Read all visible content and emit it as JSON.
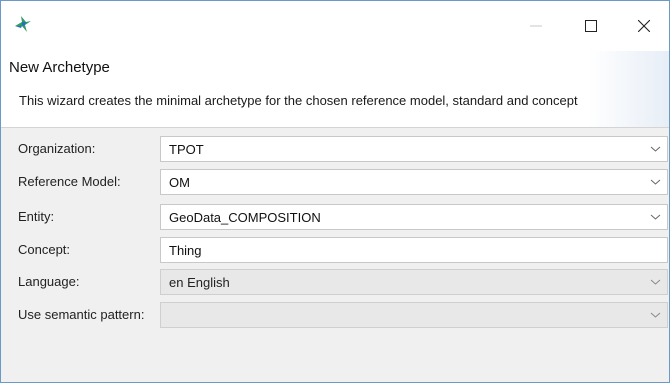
{
  "window": {
    "icon": "archetype-editor-icon",
    "controls": {
      "minimize": "minimize-icon",
      "maximize": "maximize-icon",
      "close": "close-icon"
    }
  },
  "wizard": {
    "title": "New Archetype",
    "description": "This wizard creates the minimal archetype for the chosen reference model, standard and concept"
  },
  "form": {
    "organization": {
      "label": "Organization:",
      "value": "TPOT"
    },
    "reference_model": {
      "label": "Reference Model:",
      "value": "OM"
    },
    "entity": {
      "label": "Entity:",
      "value": "GeoData_COMPOSITION"
    },
    "concept": {
      "label": "Concept:",
      "value": "Thing"
    },
    "language": {
      "label": "Language:",
      "value": "en English"
    },
    "semantic_pattern": {
      "label": "Use semantic pattern:",
      "value": ""
    }
  }
}
